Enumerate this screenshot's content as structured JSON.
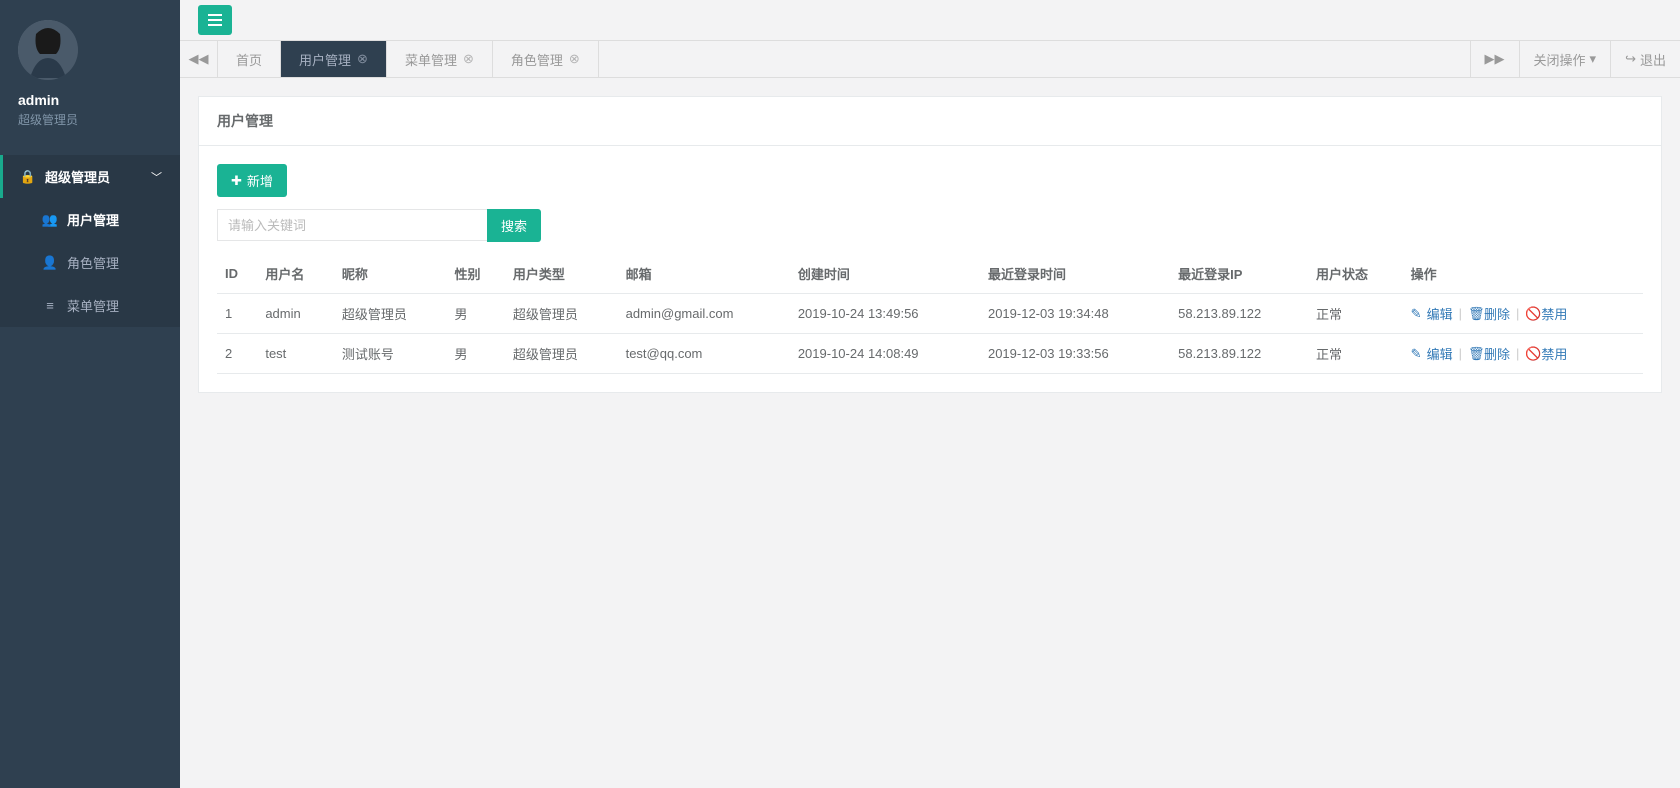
{
  "user": {
    "name": "admin",
    "role": "超级管理员"
  },
  "sidebar": {
    "top_label": "超级管理员",
    "items": [
      {
        "label": "用户管理",
        "icon": "users-icon",
        "active": true
      },
      {
        "label": "角色管理",
        "icon": "user-icon",
        "active": false
      },
      {
        "label": "菜单管理",
        "icon": "list-icon",
        "active": false
      }
    ]
  },
  "tabs": {
    "items": [
      {
        "label": "首页",
        "closable": false,
        "active": false
      },
      {
        "label": "用户管理",
        "closable": true,
        "active": true
      },
      {
        "label": "菜单管理",
        "closable": true,
        "active": false
      },
      {
        "label": "角色管理",
        "closable": true,
        "active": false
      }
    ],
    "close_ops": "关闭操作",
    "logout": "退出"
  },
  "page": {
    "title": "用户管理",
    "add_label": "新增",
    "search_placeholder": "请输入关键词",
    "search_btn": "搜索"
  },
  "table": {
    "headers": [
      "ID",
      "用户名",
      "昵称",
      "性别",
      "用户类型",
      "邮箱",
      "创建时间",
      "最近登录时间",
      "最近登录IP",
      "用户状态",
      "操作"
    ],
    "ops": {
      "edit": "编辑",
      "delete": "删除",
      "disable": "禁用"
    },
    "rows": [
      {
        "id": "1",
        "username": "admin",
        "nickname": "超级管理员",
        "gender": "男",
        "type": "超级管理员",
        "email": "admin@gmail.com",
        "created": "2019-10-24 13:49:56",
        "last_login": "2019-12-03 19:34:48",
        "last_ip": "58.213.89.122",
        "status": "正常"
      },
      {
        "id": "2",
        "username": "test",
        "nickname": "测试账号",
        "gender": "男",
        "type": "超级管理员",
        "email": "test@qq.com",
        "created": "2019-10-24 14:08:49",
        "last_login": "2019-12-03 19:33:56",
        "last_ip": "58.213.89.122",
        "status": "正常"
      }
    ]
  }
}
